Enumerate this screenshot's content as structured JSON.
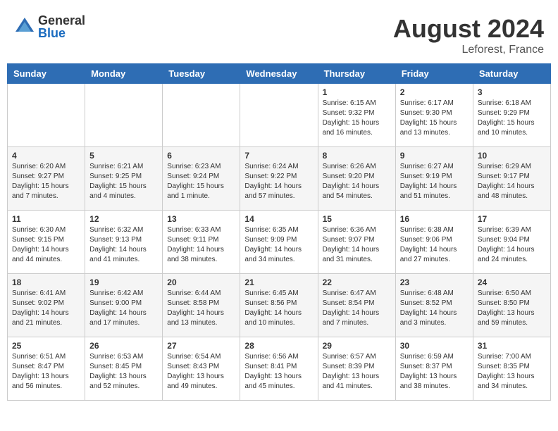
{
  "logo": {
    "general": "General",
    "blue": "Blue"
  },
  "header": {
    "month_year": "August 2024",
    "location": "Leforest, France"
  },
  "weekdays": [
    "Sunday",
    "Monday",
    "Tuesday",
    "Wednesday",
    "Thursday",
    "Friday",
    "Saturday"
  ],
  "weeks": [
    [
      {
        "day": "",
        "info": ""
      },
      {
        "day": "",
        "info": ""
      },
      {
        "day": "",
        "info": ""
      },
      {
        "day": "",
        "info": ""
      },
      {
        "day": "1",
        "info": "Sunrise: 6:15 AM\nSunset: 9:32 PM\nDaylight: 15 hours and 16 minutes."
      },
      {
        "day": "2",
        "info": "Sunrise: 6:17 AM\nSunset: 9:30 PM\nDaylight: 15 hours and 13 minutes."
      },
      {
        "day": "3",
        "info": "Sunrise: 6:18 AM\nSunset: 9:29 PM\nDaylight: 15 hours and 10 minutes."
      }
    ],
    [
      {
        "day": "4",
        "info": "Sunrise: 6:20 AM\nSunset: 9:27 PM\nDaylight: 15 hours and 7 minutes."
      },
      {
        "day": "5",
        "info": "Sunrise: 6:21 AM\nSunset: 9:25 PM\nDaylight: 15 hours and 4 minutes."
      },
      {
        "day": "6",
        "info": "Sunrise: 6:23 AM\nSunset: 9:24 PM\nDaylight: 15 hours and 1 minute."
      },
      {
        "day": "7",
        "info": "Sunrise: 6:24 AM\nSunset: 9:22 PM\nDaylight: 14 hours and 57 minutes."
      },
      {
        "day": "8",
        "info": "Sunrise: 6:26 AM\nSunset: 9:20 PM\nDaylight: 14 hours and 54 minutes."
      },
      {
        "day": "9",
        "info": "Sunrise: 6:27 AM\nSunset: 9:19 PM\nDaylight: 14 hours and 51 minutes."
      },
      {
        "day": "10",
        "info": "Sunrise: 6:29 AM\nSunset: 9:17 PM\nDaylight: 14 hours and 48 minutes."
      }
    ],
    [
      {
        "day": "11",
        "info": "Sunrise: 6:30 AM\nSunset: 9:15 PM\nDaylight: 14 hours and 44 minutes."
      },
      {
        "day": "12",
        "info": "Sunrise: 6:32 AM\nSunset: 9:13 PM\nDaylight: 14 hours and 41 minutes."
      },
      {
        "day": "13",
        "info": "Sunrise: 6:33 AM\nSunset: 9:11 PM\nDaylight: 14 hours and 38 minutes."
      },
      {
        "day": "14",
        "info": "Sunrise: 6:35 AM\nSunset: 9:09 PM\nDaylight: 14 hours and 34 minutes."
      },
      {
        "day": "15",
        "info": "Sunrise: 6:36 AM\nSunset: 9:07 PM\nDaylight: 14 hours and 31 minutes."
      },
      {
        "day": "16",
        "info": "Sunrise: 6:38 AM\nSunset: 9:06 PM\nDaylight: 14 hours and 27 minutes."
      },
      {
        "day": "17",
        "info": "Sunrise: 6:39 AM\nSunset: 9:04 PM\nDaylight: 14 hours and 24 minutes."
      }
    ],
    [
      {
        "day": "18",
        "info": "Sunrise: 6:41 AM\nSunset: 9:02 PM\nDaylight: 14 hours and 21 minutes."
      },
      {
        "day": "19",
        "info": "Sunrise: 6:42 AM\nSunset: 9:00 PM\nDaylight: 14 hours and 17 minutes."
      },
      {
        "day": "20",
        "info": "Sunrise: 6:44 AM\nSunset: 8:58 PM\nDaylight: 14 hours and 13 minutes."
      },
      {
        "day": "21",
        "info": "Sunrise: 6:45 AM\nSunset: 8:56 PM\nDaylight: 14 hours and 10 minutes."
      },
      {
        "day": "22",
        "info": "Sunrise: 6:47 AM\nSunset: 8:54 PM\nDaylight: 14 hours and 7 minutes."
      },
      {
        "day": "23",
        "info": "Sunrise: 6:48 AM\nSunset: 8:52 PM\nDaylight: 14 hours and 3 minutes."
      },
      {
        "day": "24",
        "info": "Sunrise: 6:50 AM\nSunset: 8:50 PM\nDaylight: 13 hours and 59 minutes."
      }
    ],
    [
      {
        "day": "25",
        "info": "Sunrise: 6:51 AM\nSunset: 8:47 PM\nDaylight: 13 hours and 56 minutes."
      },
      {
        "day": "26",
        "info": "Sunrise: 6:53 AM\nSunset: 8:45 PM\nDaylight: 13 hours and 52 minutes."
      },
      {
        "day": "27",
        "info": "Sunrise: 6:54 AM\nSunset: 8:43 PM\nDaylight: 13 hours and 49 minutes."
      },
      {
        "day": "28",
        "info": "Sunrise: 6:56 AM\nSunset: 8:41 PM\nDaylight: 13 hours and 45 minutes."
      },
      {
        "day": "29",
        "info": "Sunrise: 6:57 AM\nSunset: 8:39 PM\nDaylight: 13 hours and 41 minutes."
      },
      {
        "day": "30",
        "info": "Sunrise: 6:59 AM\nSunset: 8:37 PM\nDaylight: 13 hours and 38 minutes."
      },
      {
        "day": "31",
        "info": "Sunrise: 7:00 AM\nSunset: 8:35 PM\nDaylight: 13 hours and 34 minutes."
      }
    ]
  ]
}
